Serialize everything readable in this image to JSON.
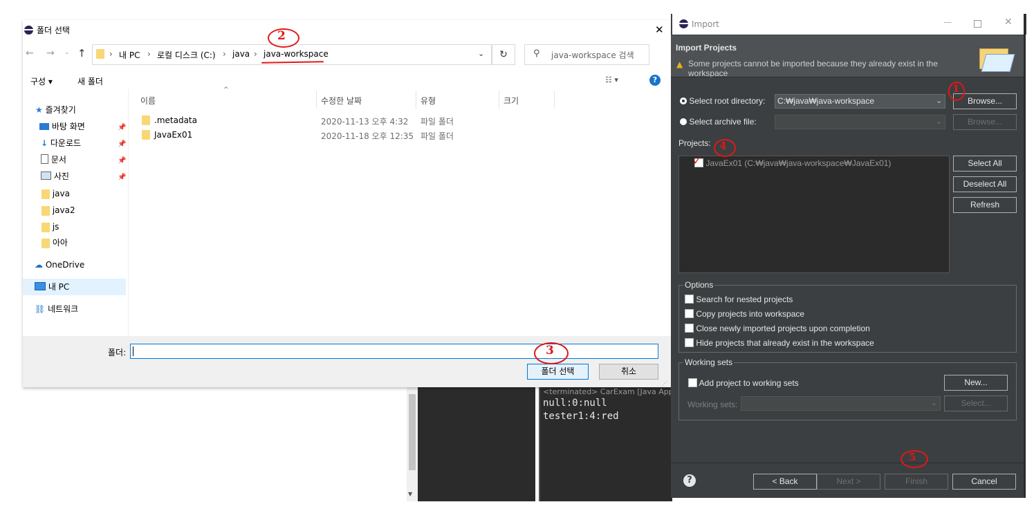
{
  "folder_dialog": {
    "title": "폴더 선택",
    "close": "✕",
    "breadcrumb": [
      "내 PC",
      "로컬 디스크 (C:)",
      "java",
      "java-workspace"
    ],
    "search_placeholder": "java-workspace 검색",
    "toolbar": {
      "organize": "구성 ▾",
      "new_folder": "새 폴더"
    },
    "columns": {
      "name": "이름",
      "modified": "수정한 날짜",
      "type": "유형",
      "size": "크기"
    },
    "files": [
      {
        "name": ".metadata",
        "modified": "2020-11-13 오후 4:32",
        "type": "파일 폴더"
      },
      {
        "name": "JavaEx01",
        "modified": "2020-11-18 오후 12:35",
        "type": "파일 폴더"
      }
    ],
    "nav": {
      "quick_access": "즐겨찾기",
      "desktop": "바탕 화면",
      "downloads": "다운로드",
      "documents": "문서",
      "pictures": "사진",
      "java": "java",
      "java2": "java2",
      "js": "js",
      "aa": "아아",
      "onedrive": "OneDrive",
      "this_pc": "내 PC",
      "network": "네트워크"
    },
    "folder_label": "폴더:",
    "select_button": "폴더 선택",
    "cancel_button": "취소"
  },
  "console": {
    "header": "<terminated> CarExam [Java Appli",
    "lines": [
      "null:0:null",
      "tester1:4:red"
    ]
  },
  "import_dialog": {
    "title": "Import",
    "heading": "Import Projects",
    "warning": "Some projects cannot be imported because they already exist in the workspace",
    "root_label": "Select root directory:",
    "root_value": "C:₩java₩java-workspace",
    "archive_label": "Select archive file:",
    "browse": "Browse...",
    "projects_label": "Projects:",
    "project_item": "JavaEx01 (C:₩java₩java-workspace₩JavaEx01)",
    "select_all": "Select All",
    "deselect_all": "Deselect All",
    "refresh": "Refresh",
    "options_label": "Options",
    "options": [
      "Search for nested projects",
      "Copy projects into workspace",
      "Close newly imported projects upon completion",
      "Hide projects that already exist in the workspace"
    ],
    "working_sets_label": "Working sets",
    "add_to_ws": "Add project to working sets",
    "new_button": "New...",
    "ws_label": "Working sets:",
    "select_button": "Select...",
    "back": "< Back",
    "next": "Next >",
    "finish": "Finish",
    "cancel": "Cancel",
    "help": "?"
  },
  "annotations": {
    "a1": "1",
    "a2": "2",
    "a3": "3",
    "a4": "4",
    "a5": "5"
  }
}
